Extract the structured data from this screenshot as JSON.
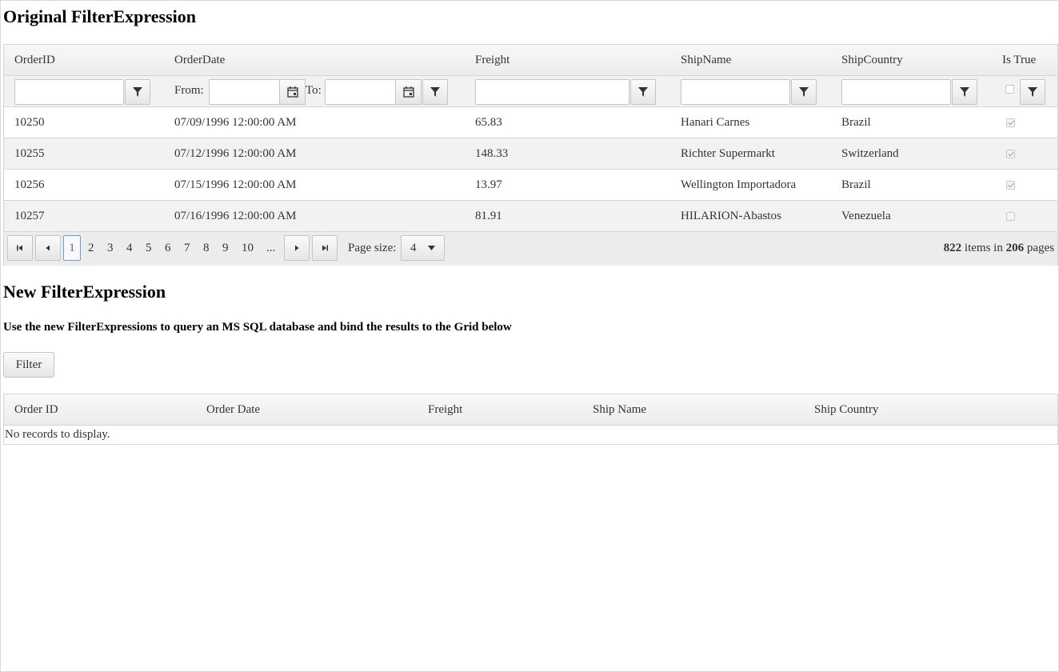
{
  "section1": {
    "title": "Original FilterExpression"
  },
  "grid1": {
    "headers": [
      "OrderID",
      "OrderDate",
      "Freight",
      "ShipName",
      "ShipCountry",
      "Is True"
    ],
    "filter": {
      "from_label": "From:",
      "to_label": "To:"
    },
    "rows": [
      {
        "id": "10250",
        "date": "07/09/1996 12:00:00 AM",
        "freight": "65.83",
        "ship_name": "Hanari Carnes",
        "country": "Brazil",
        "is_true": true
      },
      {
        "id": "10255",
        "date": "07/12/1996 12:00:00 AM",
        "freight": "148.33",
        "ship_name": "Richter Supermarkt",
        "country": "Switzerland",
        "is_true": true
      },
      {
        "id": "10256",
        "date": "07/15/1996 12:00:00 AM",
        "freight": "13.97",
        "ship_name": "Wellington Importadora",
        "country": "Brazil",
        "is_true": true
      },
      {
        "id": "10257",
        "date": "07/16/1996 12:00:00 AM",
        "freight": "81.91",
        "ship_name": "HILARION-Abastos",
        "country": "Venezuela",
        "is_true": false
      }
    ],
    "pager": {
      "pages": [
        "1",
        "2",
        "3",
        "4",
        "5",
        "6",
        "7",
        "8",
        "9",
        "10",
        "..."
      ],
      "current_page": "1",
      "page_size_label": "Page size:",
      "page_size": "4",
      "total_items": "822",
      "items_in_label": "items in",
      "total_pages": "206",
      "pages_label": "pages"
    }
  },
  "section2": {
    "title": "New FilterExpression",
    "description": "Use the new FilterExpressions to query an MS SQL database and bind the results to the Grid below",
    "filter_button": "Filter"
  },
  "grid2": {
    "headers": [
      "Order ID",
      "Order Date",
      "Freight",
      "Ship Name",
      "Ship Country"
    ],
    "empty_message": "No records to display."
  },
  "icons": [
    "filter-icon",
    "calendar-icon",
    "first-page-icon",
    "prev-page-icon",
    "next-page-icon",
    "last-page-icon",
    "dropdown-arrow-icon"
  ]
}
